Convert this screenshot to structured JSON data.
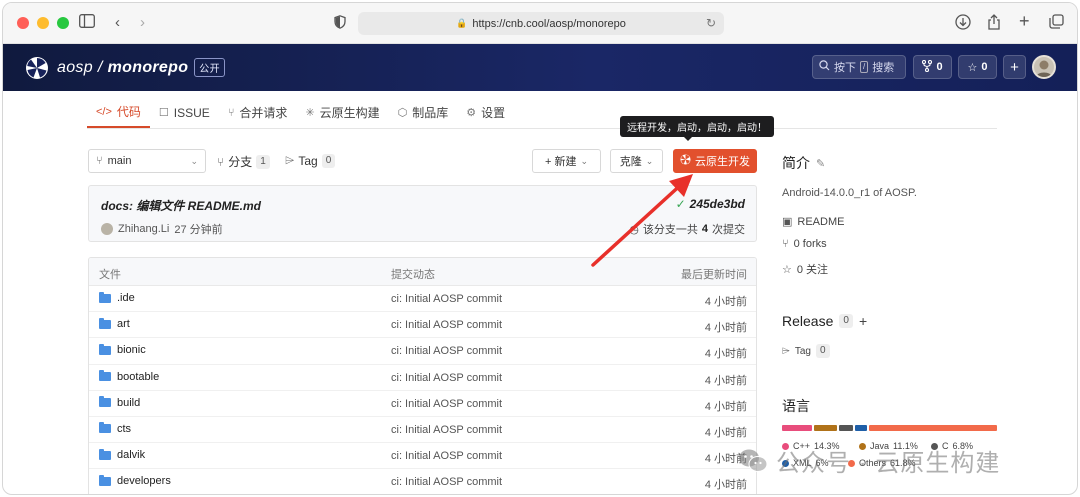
{
  "browser": {
    "url": "https://cnb.cool/aosp/monorepo"
  },
  "header": {
    "owner": "aosp",
    "separator": "/",
    "repo": "monorepo",
    "visibility": "公开",
    "search_key": "按下",
    "search_slash": "/",
    "search_label": "搜索",
    "forks_count": "0",
    "stars_count": "0",
    "plus": "+"
  },
  "tabs": [
    {
      "label": "代码",
      "icon": "code-icon"
    },
    {
      "label": "ISSUE",
      "icon": "issue-icon"
    },
    {
      "label": "合并请求",
      "icon": "merge-request-icon"
    },
    {
      "label": "云原生构建",
      "icon": "cloud-build-icon"
    },
    {
      "label": "制品库",
      "icon": "package-icon"
    },
    {
      "label": "设置",
      "icon": "settings-icon"
    }
  ],
  "tooltip": "远程开发，启动，启动，启动！",
  "toolbar": {
    "branch": "main",
    "branches_label": "分支",
    "branches_count": "1",
    "tags_label": "Tag",
    "tags_count": "0",
    "new_label": "+ 新建",
    "clone_label": "克隆",
    "dev_label": "云原生开发"
  },
  "commit": {
    "message": "docs: 编辑文件 README.md",
    "hash": "245de3bd",
    "author": "Zhihang.Li",
    "time": "27 分钟前",
    "count_prefix": "该分支一共",
    "count": "4",
    "count_suffix": "次提交"
  },
  "file_table": {
    "headers": [
      "文件",
      "提交动态",
      "最后更新时间"
    ],
    "rows": [
      {
        "name": ".ide",
        "message": "ci: Initial AOSP commit",
        "time": "4 小时前"
      },
      {
        "name": "art",
        "message": "ci: Initial AOSP commit",
        "time": "4 小时前"
      },
      {
        "name": "bionic",
        "message": "ci: Initial AOSP commit",
        "time": "4 小时前"
      },
      {
        "name": "bootable",
        "message": "ci: Initial AOSP commit",
        "time": "4 小时前"
      },
      {
        "name": "build",
        "message": "ci: Initial AOSP commit",
        "time": "4 小时前"
      },
      {
        "name": "cts",
        "message": "ci: Initial AOSP commit",
        "time": "4 小时前"
      },
      {
        "name": "dalvik",
        "message": "ci: Initial AOSP commit",
        "time": "4 小时前"
      },
      {
        "name": "developers",
        "message": "ci: Initial AOSP commit",
        "time": "4 小时前"
      }
    ]
  },
  "sidebar": {
    "intro_title": "简介",
    "description": "Android-14.0.0_r1 of AOSP.",
    "readme": "README",
    "forks": "0 forks",
    "watch": "0 关注",
    "release_title": "Release",
    "release_count": "0",
    "tag_label": "Tag",
    "tag_count": "0",
    "lang_title": "语言",
    "languages": [
      {
        "name": "C++",
        "percent": "14.3%",
        "color": "#e84d7c",
        "share": 14.3
      },
      {
        "name": "Java",
        "percent": "11.1%",
        "color": "#b07219",
        "share": 11.1
      },
      {
        "name": "C",
        "percent": "6.8%",
        "color": "#555555",
        "share": 6.8
      },
      {
        "name": "XML",
        "percent": "6%",
        "color": "#1f5fa8",
        "share": 6
      },
      {
        "name": "Others",
        "percent": "61.8%",
        "color": "#f26a4a",
        "share": 61.8
      }
    ]
  },
  "watermark": "公众号 · 云原生构建"
}
